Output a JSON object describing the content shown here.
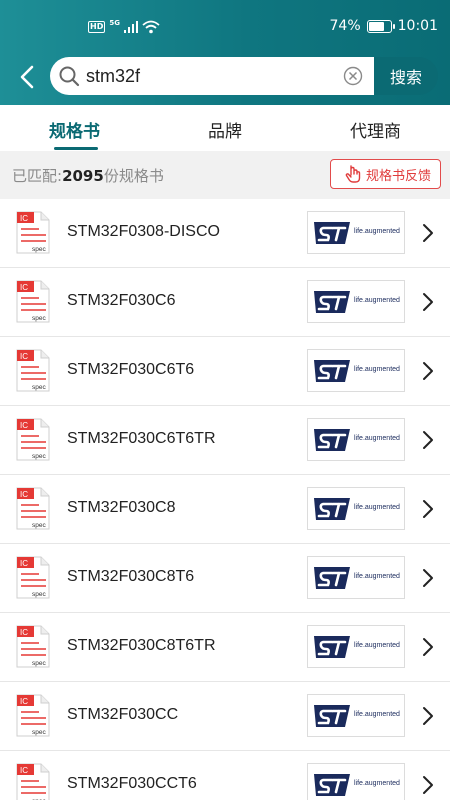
{
  "status_bar": {
    "hd": "HD",
    "network": "5G",
    "battery": "74%",
    "battery_level": 0.74,
    "time": "10:01"
  },
  "search": {
    "query": "stm32f",
    "button_label": "搜索"
  },
  "tabs": [
    {
      "label": "规格书",
      "active": true
    },
    {
      "label": "品牌",
      "active": false
    },
    {
      "label": "代理商",
      "active": false
    }
  ],
  "match": {
    "prefix": "已匹配:",
    "count": "2095",
    "suffix": "份规格书",
    "feedback_label": "规格书反馈"
  },
  "doc_icon": {
    "top_text": "IC",
    "bottom_text": "spec"
  },
  "brand": {
    "tagline": "life.augmented"
  },
  "colors": {
    "accent": "#0b6a73",
    "feedback_red": "#e03c3c",
    "st_navy": "#1a2a5c"
  },
  "results": [
    {
      "name": "STM32F0308-DISCO"
    },
    {
      "name": "STM32F030C6"
    },
    {
      "name": "STM32F030C6T6"
    },
    {
      "name": "STM32F030C6T6TR"
    },
    {
      "name": "STM32F030C8"
    },
    {
      "name": "STM32F030C8T6"
    },
    {
      "name": "STM32F030C8T6TR"
    },
    {
      "name": "STM32F030CC"
    },
    {
      "name": "STM32F030CCT6"
    }
  ]
}
